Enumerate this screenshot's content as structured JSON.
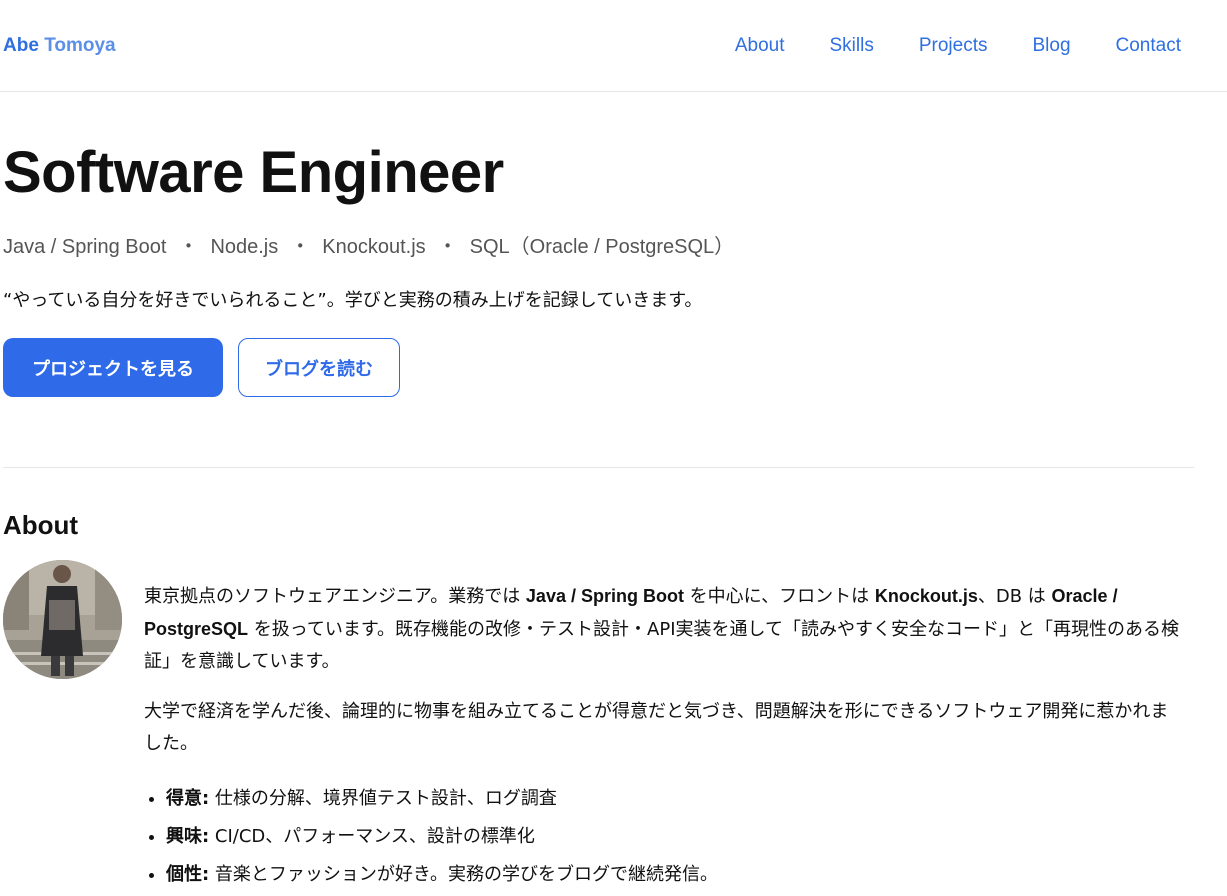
{
  "header": {
    "brand_first": "Abe",
    "brand_last": "Tomoya",
    "nav": [
      "About",
      "Skills",
      "Projects",
      "Blog",
      "Contact"
    ]
  },
  "hero": {
    "title": "Software Engineer",
    "stack": [
      "Java / Spring Boot",
      "Node.js",
      "Knockout.js",
      "SQL（Oracle / PostgreSQL）"
    ],
    "stack_separator": "・",
    "motto": "“やっている自分を好きでいられること”。学びと実務の積み上げを記録していきます。",
    "primary_button": "プロジェクトを見る",
    "secondary_button": "ブログを読む"
  },
  "about": {
    "heading": "About",
    "p1_a": "東京拠点のソフトウェアエンジニア。業務では ",
    "p1_b": "Java / Spring Boot",
    "p1_c": " を中心に、フロントは ",
    "p1_d": "Knockout.js",
    "p1_e": "、DB は ",
    "p1_f": "Oracle / PostgreSQL",
    "p1_g": " を扱っています。既存機能の改修・テスト設計・API実装を通して「読みやすく安全なコード」と「再現性のある検証」を意識しています。",
    "p2": "大学で経済を学んだ後、論理的に物事を組み立てることが得意だと気づき、問題解決を形にできるソフトウェア開発に惹かれました。",
    "traits": [
      {
        "label": "得意:",
        "text": " 仕様の分解、境界値テスト設計、ログ調査"
      },
      {
        "label": "興味:",
        "text": " CI/CD、パフォーマンス、設計の標準化"
      },
      {
        "label": "個性:",
        "text": " 音楽とファッションが好き。実務の学びをブログで継続発信。"
      }
    ]
  }
}
